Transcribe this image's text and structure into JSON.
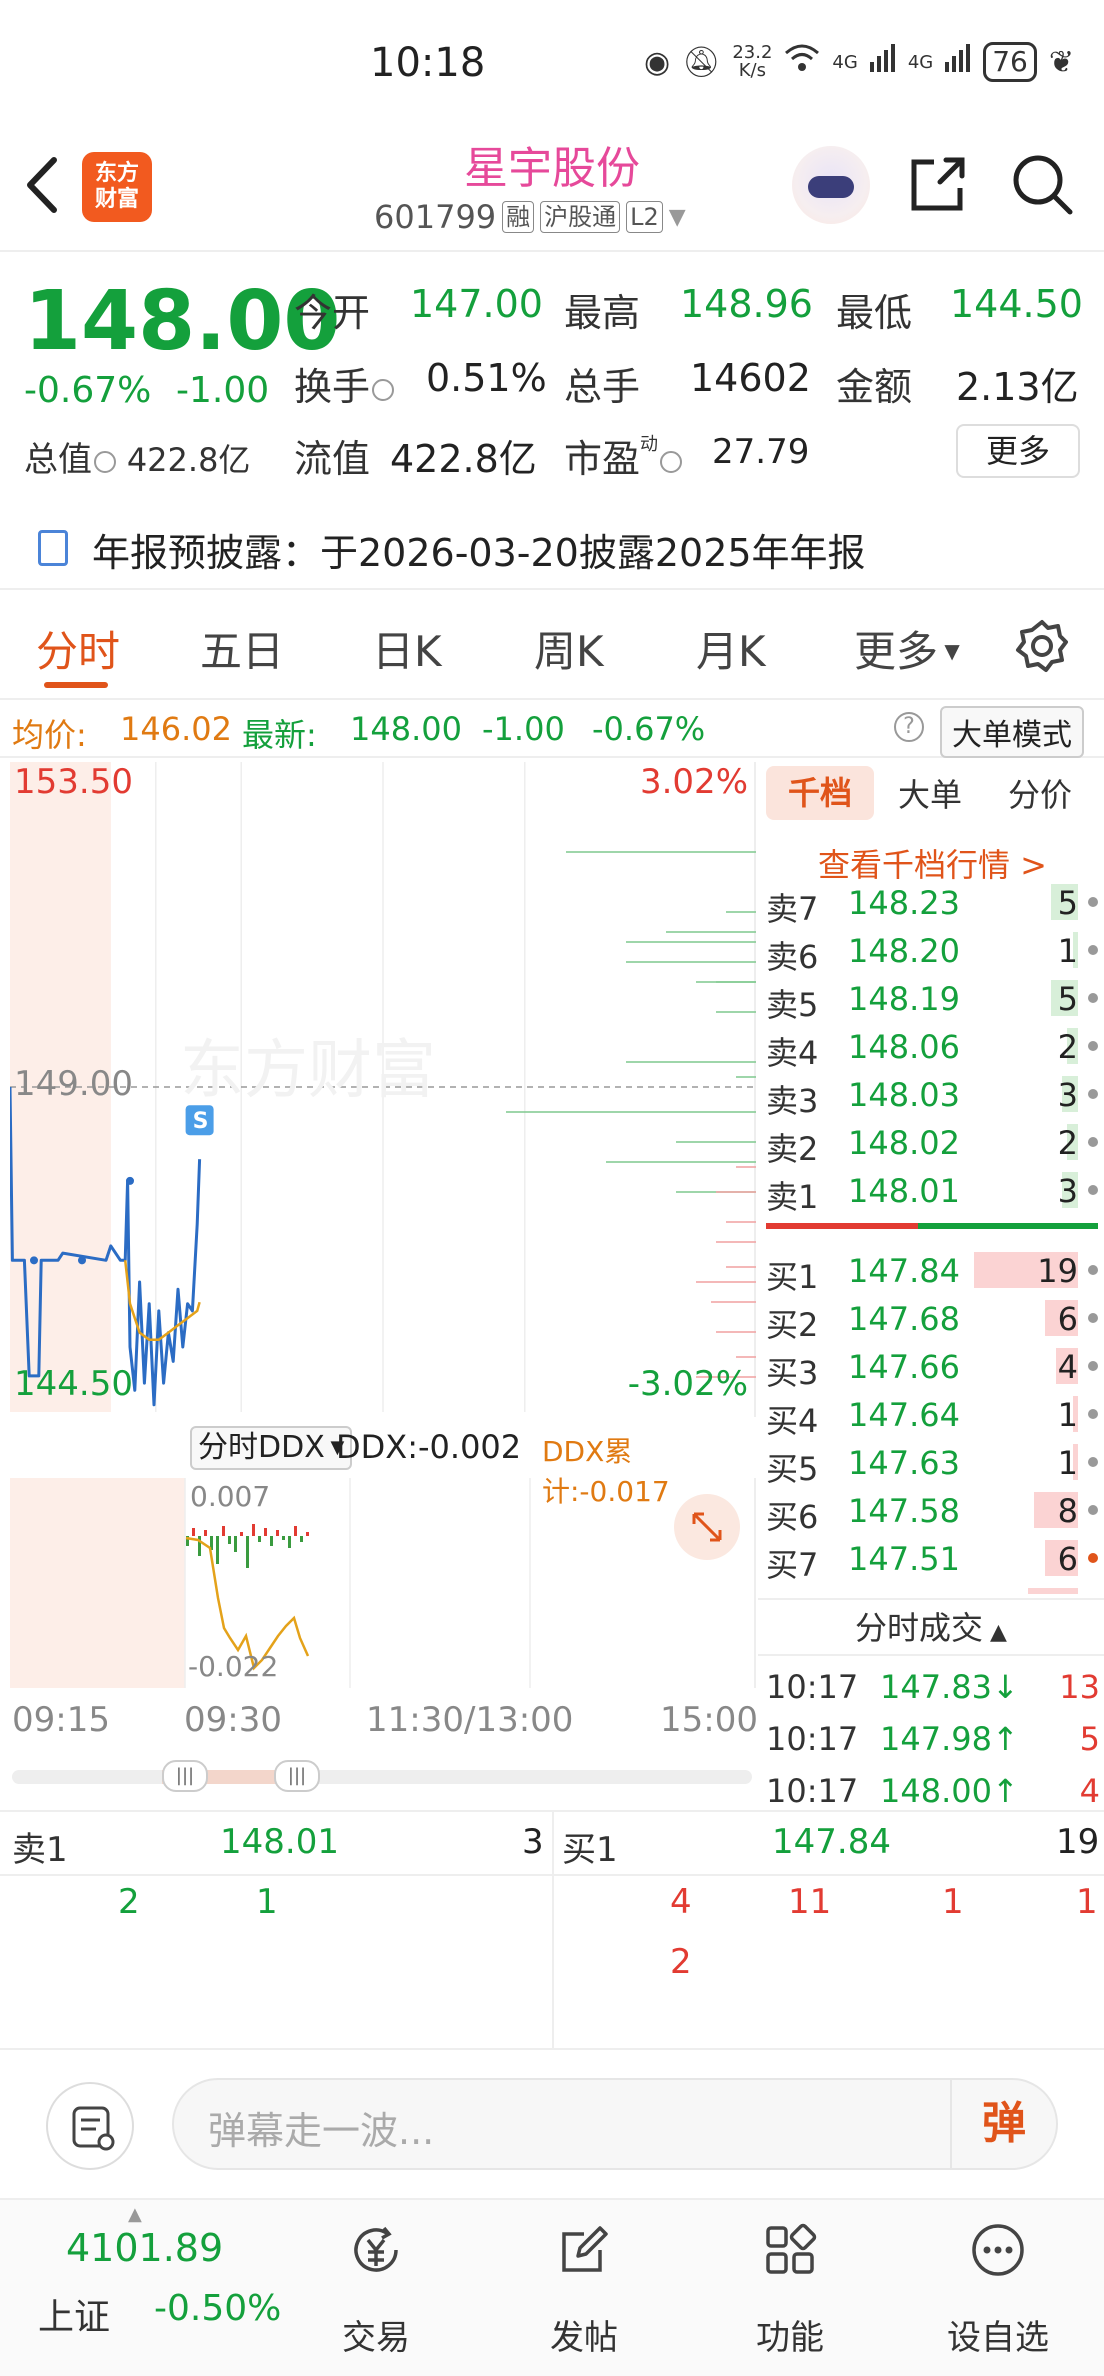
{
  "status_bar": {
    "time": "10:18",
    "net_speed_top": "23.2",
    "net_speed_unit": "K/s",
    "signal1": "4G",
    "signal2": "4G",
    "battery": "76"
  },
  "header": {
    "back_icon": "chevron-left-icon",
    "logo_line1": "东方",
    "logo_line2": "财富",
    "stock_name": "星宇股份",
    "stock_code": "601799",
    "tags": [
      "融",
      "沪股通",
      "L2"
    ],
    "share_icon": "share-icon",
    "search_icon": "search-icon"
  },
  "quote": {
    "price": "148.00",
    "change_pct": "-0.67%",
    "change": "-1.00",
    "open_label": "今开",
    "open": "147.00",
    "high_label": "最高",
    "high": "148.96",
    "low_label": "最低",
    "low": "144.50",
    "turnover_label": "换手",
    "turnover": "0.51%",
    "volume_label": "总手",
    "volume": "14602",
    "amount_label": "金额",
    "amount": "2.13亿",
    "mktcap_label": "总值",
    "mktcap": "422.8亿",
    "float_label": "流值",
    "float": "422.8亿",
    "pe_label": "市盈",
    "pe_sup": "动",
    "pe": "27.79",
    "more_button": "更多"
  },
  "notice": {
    "text": "年报预披露：于2026-03-20披露2025年年报"
  },
  "tabs": {
    "items": [
      "分时",
      "五日",
      "日K",
      "周K",
      "月K",
      "更多"
    ],
    "active": "分时"
  },
  "avg_bar": {
    "avg_label": "均价:",
    "avg": "146.02",
    "latest_label": "最新:",
    "latest": "148.00",
    "change": "-1.00",
    "change_pct": "-0.67%",
    "big_order_button": "大单模式"
  },
  "chart_data": {
    "type": "line",
    "title": "",
    "y_top_label": "153.50",
    "y_mid_label": "149.00",
    "y_bottom_label": "144.50",
    "pct_top_label": "3.02%",
    "pct_bottom_label": "-3.02%",
    "x_labels": [
      "09:15",
      "09:30",
      "11:30/13:00",
      "15:00"
    ],
    "ylim": [
      144.5,
      153.5
    ],
    "prev_close": 149.0,
    "marker": "S",
    "series": [
      {
        "color": "#2b6cc4",
        "values": [
          [
            0,
            149.0
          ],
          [
            1,
            146.6
          ],
          [
            6,
            146.6
          ],
          [
            8,
            145.0
          ],
          [
            12,
            145.0
          ],
          [
            13,
            146.6
          ],
          [
            20,
            146.6
          ],
          [
            22,
            146.7
          ],
          [
            40,
            146.6
          ],
          [
            42,
            146.8
          ],
          [
            46,
            146.6
          ],
          [
            48,
            146.6
          ],
          [
            49,
            147.7
          ],
          [
            50,
            145.4
          ],
          [
            52,
            144.8
          ],
          [
            54,
            146.3
          ],
          [
            56,
            144.9
          ],
          [
            58,
            146.0
          ],
          [
            60,
            144.6
          ],
          [
            62,
            145.9
          ],
          [
            64,
            144.9
          ],
          [
            66,
            145.6
          ],
          [
            68,
            145.2
          ],
          [
            70,
            146.2
          ],
          [
            72,
            145.4
          ],
          [
            74,
            146.0
          ],
          [
            76,
            145.9
          ],
          [
            78,
            147.1
          ],
          [
            79,
            148.0
          ]
        ]
      },
      {
        "color": "#e4a21a",
        "values": [
          [
            48,
            146.6
          ],
          [
            50,
            146.0
          ],
          [
            54,
            145.6
          ],
          [
            58,
            145.5
          ],
          [
            62,
            145.5
          ],
          [
            66,
            145.6
          ],
          [
            70,
            145.7
          ],
          [
            74,
            145.8
          ],
          [
            78,
            145.9
          ],
          [
            79,
            146.02
          ]
        ]
      }
    ],
    "ddx": {
      "selector": "分时DDX",
      "ddx_label": "DDX:-0.002",
      "ddx_cum_label": "DDX累计:-0.017",
      "top_label": "0.007",
      "bottom_label": "-0.022"
    }
  },
  "order_book": {
    "tabs": [
      "千档",
      "大单",
      "分价"
    ],
    "link": "查看千档行情 >",
    "sells": [
      {
        "label": "卖7",
        "price": "148.23",
        "vol": "5"
      },
      {
        "label": "卖6",
        "price": "148.20",
        "vol": "1"
      },
      {
        "label": "卖5",
        "price": "148.19",
        "vol": "5"
      },
      {
        "label": "卖4",
        "price": "148.06",
        "vol": "2"
      },
      {
        "label": "卖3",
        "price": "148.03",
        "vol": "3"
      },
      {
        "label": "卖2",
        "price": "148.02",
        "vol": "2"
      },
      {
        "label": "卖1",
        "price": "148.01",
        "vol": "3"
      }
    ],
    "buys": [
      {
        "label": "买1",
        "price": "147.84",
        "vol": "19"
      },
      {
        "label": "买2",
        "price": "147.68",
        "vol": "6"
      },
      {
        "label": "买3",
        "price": "147.66",
        "vol": "4"
      },
      {
        "label": "买4",
        "price": "147.64",
        "vol": "1"
      },
      {
        "label": "买5",
        "price": "147.63",
        "vol": "1"
      },
      {
        "label": "买6",
        "price": "147.58",
        "vol": "8"
      },
      {
        "label": "买7",
        "price": "147.51",
        "vol": "6"
      }
    ],
    "ticks_title": "分时成交",
    "ticks": [
      {
        "time": "10:17",
        "price": "147.83↓",
        "vol": "13"
      },
      {
        "time": "10:17",
        "price": "147.98↑",
        "vol": "5"
      },
      {
        "time": "10:17",
        "price": "148.00↑",
        "vol": "4"
      }
    ]
  },
  "level1": {
    "sell_label": "卖1",
    "sell_price": "148.01",
    "sell_vol": "3",
    "buy_label": "买1",
    "buy_price": "147.84",
    "buy_vol": "19",
    "sell_queue": [
      "2",
      "1"
    ],
    "buy_queue": [
      "4",
      "11",
      "1",
      "1",
      "2"
    ]
  },
  "comment": {
    "placeholder": "弹幕走一波...",
    "send_label": "弹"
  },
  "bottom_nav": {
    "index_value": "4101.89",
    "index_name": "上证",
    "index_change": "-0.50%",
    "items": [
      "交易",
      "发帖",
      "功能",
      "设自选"
    ]
  },
  "colors": {
    "up": "#e23b32",
    "down": "#14a03c",
    "accent": "#e0541a",
    "name": "#e6499a",
    "price_line": "#2b6cc4",
    "avg_line": "#e4a21a"
  }
}
